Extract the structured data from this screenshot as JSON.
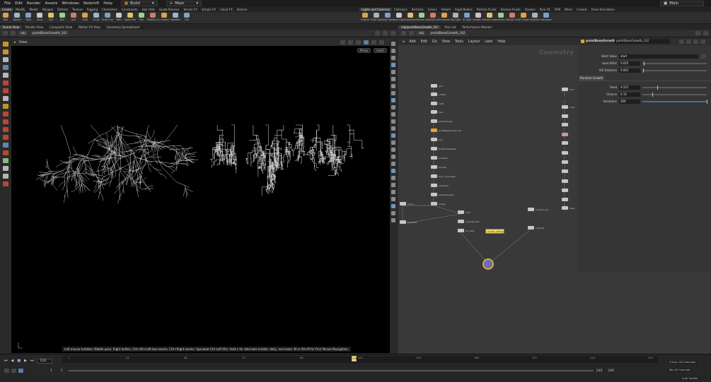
{
  "menubar": {
    "items": [
      "File",
      "Edit",
      "Render",
      "Assets",
      "Windows",
      "Redshift",
      "Help"
    ],
    "desktop": "Build",
    "desktop2": "Main",
    "right_desktop": "Main"
  },
  "shelf_tabs_left": [
    "Create",
    "Modify",
    "Model",
    "Polygon",
    "Deform",
    "Texture",
    "Rigging",
    "Characters",
    "Constraints",
    "Hair Utils",
    "Guide Process",
    "Terrain FX",
    "Simple FX",
    "Cloud FX",
    "Volume"
  ],
  "shelf_tabs_right": [
    "Lights and Cameras",
    "Collisions",
    "Particles",
    "Grains",
    "Vellum",
    "Rigid Bodies",
    "Particle Fluids",
    "Viscous Fluids",
    "Oceans",
    "Pyro FX",
    "FEM",
    "Wires",
    "Crowds",
    "Drive Simulation"
  ],
  "tools_left": [
    "Box",
    "Sphere",
    "Tube",
    "Torus",
    "Grid",
    "Null",
    "Line",
    "Circle",
    "Curve",
    "Draw Curve",
    "Path",
    "Spray Paint",
    "Font",
    "Platonic Solids",
    "L-System",
    "Metaball",
    "File"
  ],
  "tools_right": [
    "Camera",
    "Point Light",
    "Spot Light",
    "Area Light",
    "Geometry Light",
    "Volume Light",
    "Distant Light",
    "Environment Light",
    "Sky Light",
    "GI Light",
    "Caustic Light",
    "Portal Light",
    "Ambient Light",
    "Stereo Camera",
    "VR Camera",
    "Switcher",
    "Gamepad Camera"
  ],
  "pane_tabs_left": [
    "Scene View",
    "Render View",
    "Composite View",
    "Motion FX View",
    "Geometry Spreadsheet"
  ],
  "pane_tabs_right": [
    "/obj/pointBaseGrowth_1t2",
    "Tree List",
    "Performance Monitor"
  ],
  "left_path": {
    "net": "obj",
    "node": "pointBaseGrowth_1t2"
  },
  "right_path": {
    "net": "obj",
    "node": "pointBaseGrowth_1t2"
  },
  "viewport": {
    "title": "View",
    "persp": "Persp",
    "cam": "cam1",
    "status": "Left mouse tumbles. Middle pans. Right dollies. Ctrl+Alt+Left box-zooms. Ctrl+Right zooms. Spacebar-Ctrl-Left tilts. Hold L for alternate tumble, dolly, and zoom.    M or Alt+M for First Person Navigation."
  },
  "network": {
    "menu": [
      "Add",
      "Edit",
      "Go",
      "View",
      "Tools",
      "Layout",
      "Labs",
      "Help"
    ],
    "watermark": "Geometry"
  },
  "network_nodes": [
    {
      "label": "grid"
    },
    {
      "label": "scatter"
    },
    {
      "label": "add1"
    },
    {
      "label": "fuse"
    },
    {
      "label": "pointwrangle"
    },
    {
      "label": "pointBaseGrowth_1t2"
    },
    {
      "label": "sort"
    },
    {
      "label": "findshortestpath"
    },
    {
      "label": "polywire"
    },
    {
      "label": "smooth"
    },
    {
      "label": "trail_rnd_pregen"
    },
    {
      "label": "resample"
    },
    {
      "label": "pointwrangle2"
    },
    {
      "label": "merge"
    },
    {
      "label": "carve"
    },
    {
      "label": "timeshift"
    },
    {
      "label": "color"
    },
    {
      "label": "copytopoints"
    },
    {
      "label": "for_start"
    },
    {
      "label": "foreach_end"
    },
    {
      "label": "output0"
    },
    {
      "label": "OUT"
    },
    {
      "label": "null1"
    },
    {
      "label": "blast"
    }
  ],
  "network_note": "growth_settings",
  "parms": {
    "node_type": "pointBaseGrowth",
    "node_name": "pointBaseGrowth_1t2",
    "startvalue_label": "Start Value",
    "startvalue": "start",
    "searchdist_label": "searchDist",
    "searchdist": "0.025",
    "searchdist_frac": 0.02,
    "killdist_label": "Kill Distance",
    "killdist": "0.001",
    "killdist_frac": 0.01,
    "folder": "Random Growth",
    "seed_label": "Seed",
    "seed": "0.221",
    "seed_frac": 0.23,
    "chance_label": "Chance",
    "chance": "0.15",
    "chance_frac": 0.15,
    "iter_label": "Iterations",
    "iter": "209",
    "iter_frac": 1.0
  },
  "timeline": {
    "frame": "119",
    "start": "1",
    "start2": "1",
    "end": "240",
    "end2": "240",
    "ticks": [
      "1",
      "24",
      "48",
      "72",
      "96",
      "120",
      "144",
      "168",
      "192",
      "216",
      "240"
    ],
    "keys": "0 keys, 0/0 channels",
    "key_channels": "Key All Channels",
    "auto": "Auto Update",
    "current_marker": "119"
  },
  "colors": {
    "accent": "#e4a52a",
    "viewport": "#000000",
    "net_bg": "#393939",
    "wire": "#6a96c4"
  }
}
